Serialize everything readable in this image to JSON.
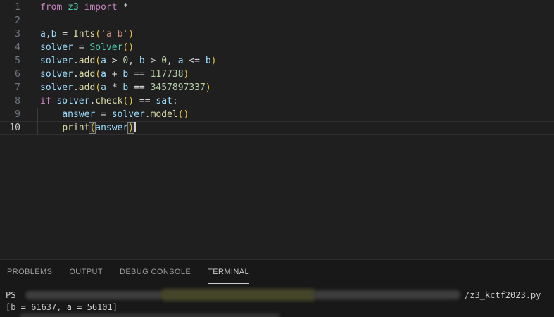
{
  "colors": {
    "editor_bg": "#1f1f1f",
    "panel_bg": "#181818",
    "gutter": "#6e7681",
    "line_highlight_border": "#2e2e2e",
    "syntax": {
      "keyword": "#C586C0",
      "type": "#4EC9B0",
      "variable": "#9CDCFE",
      "function": "#DCDCAA",
      "string": "#CE9178",
      "number": "#B5CEA8",
      "operator": "#D4D4D4",
      "bracket": "#E8C543"
    }
  },
  "editor": {
    "lines": [
      {
        "num": "1",
        "tokens": [
          [
            "kw",
            "from"
          ],
          [
            "plain",
            " "
          ],
          [
            "type",
            "z3"
          ],
          [
            "plain",
            " "
          ],
          [
            "kw",
            "import"
          ],
          [
            "op",
            " *"
          ]
        ]
      },
      {
        "num": "2",
        "tokens": []
      },
      {
        "num": "3",
        "tokens": [
          [
            "var",
            "a"
          ],
          [
            "op",
            ","
          ],
          [
            "var",
            "b"
          ],
          [
            "op",
            " = "
          ],
          [
            "fn",
            "Ints"
          ],
          [
            "br",
            "("
          ],
          [
            "str",
            "'a b'"
          ],
          [
            "br",
            ")"
          ]
        ]
      },
      {
        "num": "4",
        "tokens": [
          [
            "var",
            "solver"
          ],
          [
            "op",
            " = "
          ],
          [
            "type",
            "Solver"
          ],
          [
            "br",
            "()"
          ]
        ]
      },
      {
        "num": "5",
        "tokens": [
          [
            "var",
            "solver"
          ],
          [
            "op",
            "."
          ],
          [
            "fn",
            "add"
          ],
          [
            "br",
            "("
          ],
          [
            "var",
            "a"
          ],
          [
            "op",
            " > "
          ],
          [
            "num",
            "0"
          ],
          [
            "op",
            ", "
          ],
          [
            "var",
            "b"
          ],
          [
            "op",
            " > "
          ],
          [
            "num",
            "0"
          ],
          [
            "op",
            ", "
          ],
          [
            "var",
            "a"
          ],
          [
            "op",
            " <= "
          ],
          [
            "var",
            "b"
          ],
          [
            "br",
            ")"
          ]
        ]
      },
      {
        "num": "6",
        "tokens": [
          [
            "var",
            "solver"
          ],
          [
            "op",
            "."
          ],
          [
            "fn",
            "add"
          ],
          [
            "br",
            "("
          ],
          [
            "var",
            "a"
          ],
          [
            "op",
            " + "
          ],
          [
            "var",
            "b"
          ],
          [
            "op",
            " == "
          ],
          [
            "num",
            "117738"
          ],
          [
            "br",
            ")"
          ]
        ]
      },
      {
        "num": "7",
        "tokens": [
          [
            "var",
            "solver"
          ],
          [
            "op",
            "."
          ],
          [
            "fn",
            "add"
          ],
          [
            "br",
            "("
          ],
          [
            "var",
            "a"
          ],
          [
            "op",
            " * "
          ],
          [
            "var",
            "b"
          ],
          [
            "op",
            " == "
          ],
          [
            "num",
            "3457897337"
          ],
          [
            "br",
            ")"
          ]
        ]
      },
      {
        "num": "8",
        "tokens": [
          [
            "kw",
            "if"
          ],
          [
            "plain",
            " "
          ],
          [
            "var",
            "solver"
          ],
          [
            "op",
            "."
          ],
          [
            "fn",
            "check"
          ],
          [
            "br",
            "()"
          ],
          [
            "op",
            " == "
          ],
          [
            "var",
            "sat"
          ],
          [
            "op",
            ":"
          ]
        ]
      },
      {
        "num": "9",
        "guide": true,
        "tokens": [
          [
            "plain",
            "    "
          ],
          [
            "var",
            "answer"
          ],
          [
            "op",
            " = "
          ],
          [
            "var",
            "solver"
          ],
          [
            "op",
            "."
          ],
          [
            "fn",
            "model"
          ],
          [
            "br",
            "()"
          ]
        ]
      },
      {
        "num": "10",
        "guide": true,
        "active": true,
        "cursor": true,
        "tokens": [
          [
            "plain",
            "    "
          ],
          [
            "fn",
            "print"
          ],
          [
            "brm",
            "("
          ],
          [
            "var",
            "answer"
          ],
          [
            "brm",
            ")"
          ]
        ]
      }
    ]
  },
  "panel": {
    "tabs": [
      {
        "label": "PROBLEMS",
        "active": false
      },
      {
        "label": "OUTPUT",
        "active": false
      },
      {
        "label": "DEBUG CONSOLE",
        "active": false
      },
      {
        "label": "TERMINAL",
        "active": true
      }
    ],
    "terminal": {
      "prompt": "PS",
      "command_file": "/z3_kctf2023.py",
      "output_line": "[b = 61637, a = 56101]"
    }
  }
}
